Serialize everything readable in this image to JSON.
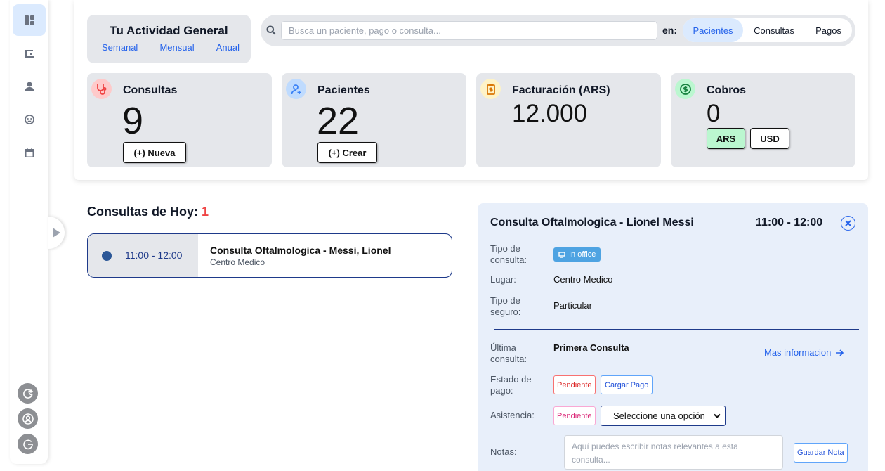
{
  "sidebar": {
    "items": [
      {
        "icon": "dashboard-icon",
        "active": true
      },
      {
        "icon": "wallet-icon",
        "active": false
      },
      {
        "icon": "user-icon",
        "active": false
      },
      {
        "icon": "face-icon",
        "active": false
      },
      {
        "icon": "calendar-icon",
        "active": false
      }
    ],
    "bottom": [
      "dark-mode-icon",
      "profile-icon",
      "logout-icon"
    ]
  },
  "activity": {
    "title": "Tu Actividad General",
    "periods": [
      "Semanal",
      "Mensual",
      "Anual"
    ]
  },
  "search": {
    "placeholder": "Busca un paciente, pago o consulta...",
    "en_label": "en:",
    "scopes": [
      "Pacientes",
      "Consultas",
      "Pagos"
    ],
    "selected_scope": "Pacientes"
  },
  "stats": {
    "consultas": {
      "title": "Consultas",
      "value": "9",
      "button": "(+) Nueva"
    },
    "pacientes": {
      "title": "Pacientes",
      "value": "22",
      "button": "(+) Crear"
    },
    "facturacion": {
      "title": "Facturación (ARS)",
      "value": "12.000"
    },
    "cobros": {
      "title": "Cobros",
      "value": "0",
      "currencies": [
        "ARS",
        "USD"
      ],
      "selected_currency": "ARS"
    }
  },
  "colors": {
    "accent": "#2563eb",
    "card_bg": "#e5e7eb",
    "danger": "#ef4444",
    "success_bg": "#bbf7d0"
  },
  "today": {
    "title": "Consultas de Hoy:",
    "count": "1",
    "appointments": [
      {
        "time": "11:00 - 12:00",
        "name": "Consulta Oftalmologica - Messi, Lionel",
        "place": "Centro Medico"
      }
    ]
  },
  "detail": {
    "title": "Consulta Oftalmologica - Lionel Messi",
    "time": "11:00 - 12:00",
    "tipo_consulta_label": "Tipo de consulta:",
    "tipo_consulta_value": "In office",
    "lugar_label": "Lugar:",
    "lugar_value": "Centro Medico",
    "seguro_label": "Tipo de seguro:",
    "seguro_value": "Particular",
    "ultima_label": "Última consulta:",
    "ultima_value": "Primera Consulta",
    "mas_info": "Mas informacion",
    "estado_label": "Estado de pago:",
    "estado_value": "Pendiente",
    "cargar_pago": "Cargar Pago",
    "asistencia_label": "Asistencia:",
    "asistencia_value": "Pendiente",
    "asistencia_select": "Seleccione una opción",
    "notas_label": "Notas:",
    "notas_placeholder": "Aquí puedes escribir notas relevantes a esta consulta...",
    "guardar": "Guardar Nota"
  }
}
